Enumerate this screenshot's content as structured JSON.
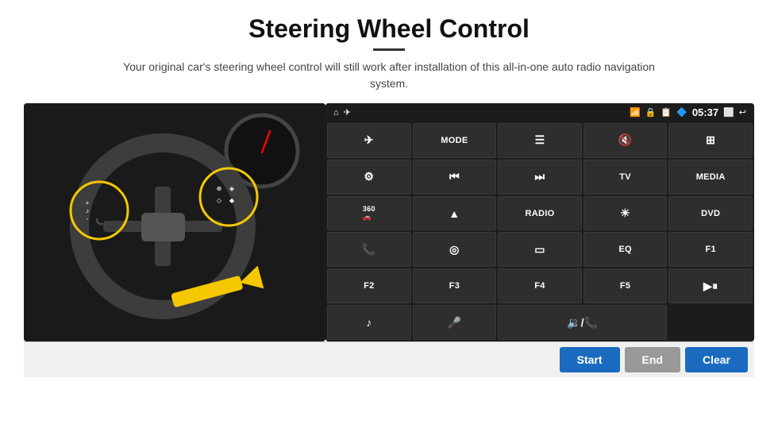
{
  "header": {
    "title": "Steering Wheel Control",
    "subtitle": "Your original car's steering wheel control will still work after installation of this all-in-one auto radio navigation system."
  },
  "status_bar": {
    "time": "05:37",
    "icons": [
      "wifi",
      "lock",
      "sim",
      "bluetooth",
      "cast",
      "back"
    ]
  },
  "grid_buttons": [
    {
      "id": "b1",
      "type": "icon",
      "label": "↑",
      "icon": "navigation"
    },
    {
      "id": "b2",
      "type": "text",
      "label": "MODE"
    },
    {
      "id": "b3",
      "type": "icon",
      "label": "≡",
      "icon": "list"
    },
    {
      "id": "b4",
      "type": "icon",
      "label": "🔇",
      "icon": "mute"
    },
    {
      "id": "b5",
      "type": "icon",
      "label": "⋯",
      "icon": "apps"
    },
    {
      "id": "b6",
      "type": "icon",
      "label": "⚙",
      "icon": "settings"
    },
    {
      "id": "b7",
      "type": "icon",
      "label": "⏮",
      "icon": "prev"
    },
    {
      "id": "b8",
      "type": "icon",
      "label": "⏭",
      "icon": "next"
    },
    {
      "id": "b9",
      "type": "text",
      "label": "TV"
    },
    {
      "id": "b10",
      "type": "text",
      "label": "MEDIA"
    },
    {
      "id": "b11",
      "type": "icon",
      "label": "360",
      "icon": "360"
    },
    {
      "id": "b12",
      "type": "icon",
      "label": "▲",
      "icon": "eject"
    },
    {
      "id": "b13",
      "type": "text",
      "label": "RADIO"
    },
    {
      "id": "b14",
      "type": "icon",
      "label": "☀",
      "icon": "brightness"
    },
    {
      "id": "b15",
      "type": "text",
      "label": "DVD"
    },
    {
      "id": "b16",
      "type": "icon",
      "label": "📞",
      "icon": "phone"
    },
    {
      "id": "b17",
      "type": "icon",
      "label": "◎",
      "icon": "screen"
    },
    {
      "id": "b18",
      "type": "icon",
      "label": "▭",
      "icon": "ratio"
    },
    {
      "id": "b19",
      "type": "text",
      "label": "EQ"
    },
    {
      "id": "b20",
      "type": "text",
      "label": "F1"
    },
    {
      "id": "b21",
      "type": "text",
      "label": "F2"
    },
    {
      "id": "b22",
      "type": "text",
      "label": "F3"
    },
    {
      "id": "b23",
      "type": "text",
      "label": "F4"
    },
    {
      "id": "b24",
      "type": "text",
      "label": "F5"
    },
    {
      "id": "b25",
      "type": "icon",
      "label": "▶⏸",
      "icon": "play-pause"
    },
    {
      "id": "b26",
      "type": "icon",
      "label": "♪",
      "icon": "music"
    },
    {
      "id": "b27",
      "type": "icon",
      "label": "🎤",
      "icon": "mic"
    },
    {
      "id": "b28",
      "type": "icon",
      "label": "🔉",
      "icon": "volume-phone",
      "wide": true
    }
  ],
  "bottom_bar": {
    "start_label": "Start",
    "end_label": "End",
    "clear_label": "Clear"
  },
  "colors": {
    "accent_blue": "#1a6bbf",
    "panel_dark": "#1c1c1c",
    "btn_normal": "#2e2e2e",
    "btn_disabled": "#999999"
  }
}
